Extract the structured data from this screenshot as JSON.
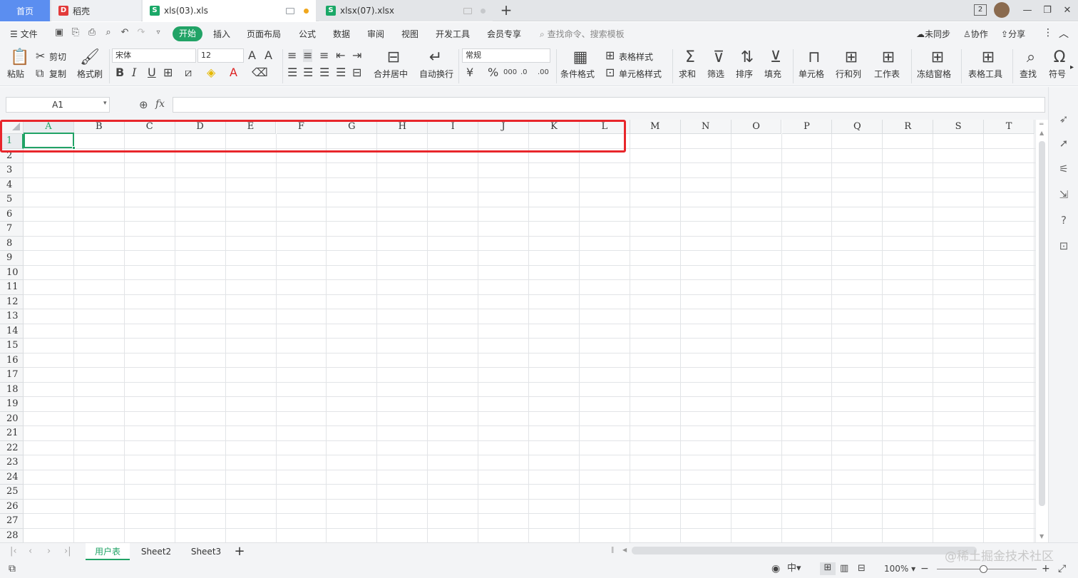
{
  "tabs": {
    "home": "首页",
    "daoke": "稻壳",
    "file1": "xls(03).xls",
    "file2": "xlsx(07).xlsx",
    "add": "+"
  },
  "window": {
    "badge": "2"
  },
  "menu": {
    "file": "文件",
    "items": [
      "开始",
      "插入",
      "页面布局",
      "公式",
      "数据",
      "审阅",
      "视图",
      "开发工具",
      "会员专享"
    ],
    "search": "查找命令、搜索模板",
    "sync": "未同步",
    "collab": "协作",
    "share": "分享"
  },
  "ribbon": {
    "paste": "粘贴",
    "cut": "剪切",
    "copy": "复制",
    "format_painter": "格式刷",
    "font": "宋体",
    "font_size": "12",
    "merge": "合并居中",
    "wrap": "自动换行",
    "number_format": "常规",
    "cond_format": "条件格式",
    "table_style": "表格样式",
    "cell_style": "单元格样式",
    "sum": "求和",
    "filter": "筛选",
    "sort": "排序",
    "fill": "填充",
    "cell": "单元格",
    "rowcol": "行和列",
    "sheet": "工作表",
    "freeze": "冻结窗格",
    "table_tools": "表格工具",
    "find": "查找",
    "symbol": "符号"
  },
  "formula": {
    "cell_ref": "A1",
    "fx": "fx",
    "content": ""
  },
  "grid": {
    "columns": [
      "A",
      "B",
      "C",
      "D",
      "E",
      "F",
      "G",
      "H",
      "I",
      "J",
      "K",
      "L",
      "M",
      "N",
      "O",
      "P",
      "Q",
      "R",
      "S",
      "T"
    ],
    "rows": [
      "1",
      "2",
      "3",
      "4",
      "5",
      "6",
      "7",
      "8",
      "9",
      "10",
      "11",
      "12",
      "13",
      "14",
      "15",
      "16",
      "17",
      "18",
      "19",
      "20",
      "21",
      "22",
      "23",
      "24",
      "25",
      "26",
      "27",
      "28"
    ],
    "selected_cell": "A1",
    "highlight": "A1:L1",
    "accent": "#21a366",
    "highlight_color": "#e8262b"
  },
  "sheets": {
    "tabs": [
      "用户表",
      "Sheet2",
      "Sheet3"
    ],
    "active": "用户表",
    "add": "+"
  },
  "status": {
    "zoom": "100%"
  },
  "watermark": "@稀土掘金技术社区"
}
